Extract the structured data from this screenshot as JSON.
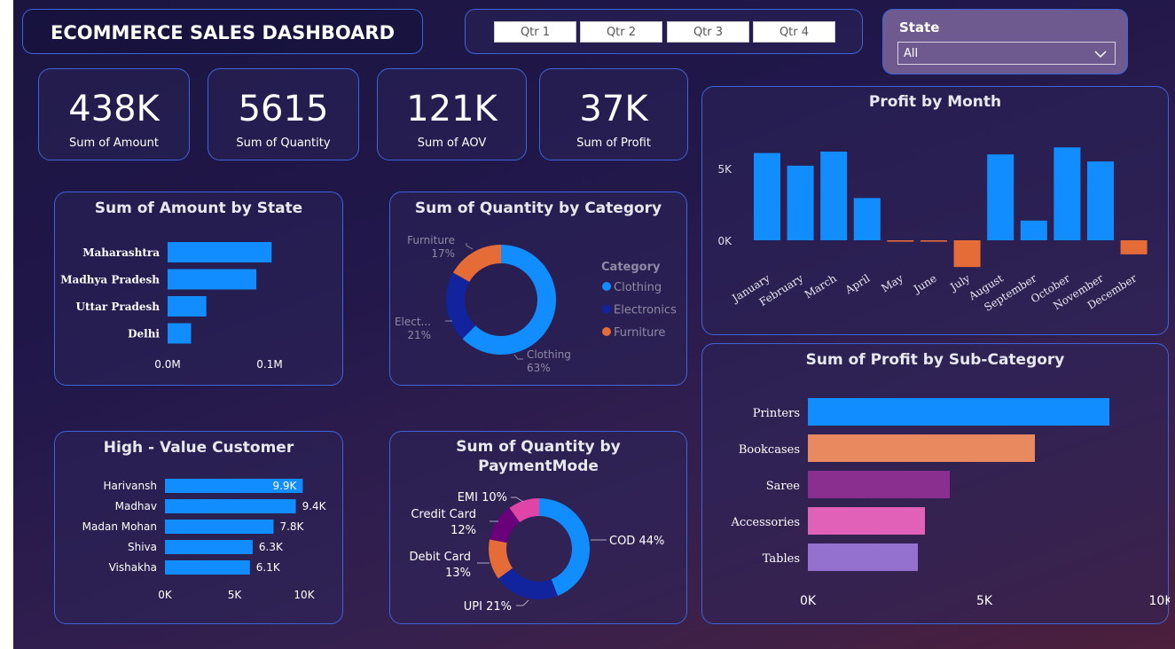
{
  "header": {
    "title": "ECOMMERCE SALES DASHBOARD"
  },
  "quarters": [
    "Qtr 1",
    "Qtr 2",
    "Qtr 3",
    "Qtr 4"
  ],
  "state_filter": {
    "label": "State",
    "value": "All"
  },
  "kpis": [
    {
      "value": "438K",
      "label": "Sum of Amount"
    },
    {
      "value": "5615",
      "label": "Sum of Quantity"
    },
    {
      "value": "121K",
      "label": "Sum of AOV"
    },
    {
      "value": "37K",
      "label": "Sum of Profit"
    }
  ],
  "colors": {
    "blue": "#118dff",
    "navy": "#12239e",
    "orange": "#e66c37",
    "purple": "#6b007b",
    "pink": "#e044a7",
    "salmon": "#e8895f",
    "violet": "#8a2f8f",
    "lavender": "#9470cf",
    "panel_border": "#3f63d8"
  },
  "chart_data": [
    {
      "id": "profit_by_month",
      "type": "bar",
      "title": "Profit by Month",
      "categories": [
        "January",
        "February",
        "March",
        "April",
        "May",
        "June",
        "July",
        "August",
        "September",
        "October",
        "November",
        "December"
      ],
      "values": [
        6200,
        5300,
        6300,
        3000,
        -100,
        -100,
        -1900,
        6100,
        1400,
        6600,
        5600,
        -1000
      ],
      "yticks": [
        "5K",
        "0K"
      ],
      "ylim": [
        -2000,
        7000
      ],
      "positive_color": "#118dff",
      "negative_color": "#e66c37"
    },
    {
      "id": "amount_by_state",
      "type": "bar",
      "orientation": "horizontal",
      "title": "Sum of Amount by State",
      "categories": [
        "Maharashtra",
        "Madhya Pradesh",
        "Uttar Pradesh",
        "Delhi"
      ],
      "values": [
        0.102,
        0.087,
        0.038,
        0.023
      ],
      "xticks": [
        "0.0M",
        "0.1M"
      ],
      "xlim": [
        0,
        0.1
      ]
    },
    {
      "id": "quantity_by_category",
      "type": "pie",
      "title": "Sum of Quantity by Category",
      "legend_title": "Category",
      "legend_position": "right",
      "slices": [
        {
          "name": "Clothing",
          "value": 63,
          "label": "Clothing",
          "pct": "63%",
          "color": "#118dff"
        },
        {
          "name": "Electronics",
          "value": 21,
          "label": "Elect...",
          "pct": "21%",
          "color": "#12239e"
        },
        {
          "name": "Furniture",
          "value": 17,
          "label": "Furniture",
          "pct": "17%",
          "color": "#e66c37"
        }
      ]
    },
    {
      "id": "high_value_customer",
      "type": "bar",
      "orientation": "horizontal",
      "title": "High - Value Customer",
      "categories": [
        "Harivansh",
        "Madhav",
        "Madan Mohan",
        "Shiva",
        "Vishakha"
      ],
      "values": [
        9.9,
        9.4,
        7.8,
        6.3,
        6.1
      ],
      "data_labels": [
        "9.9K",
        "9.4K",
        "7.8K",
        "6.3K",
        "6.1K"
      ],
      "xticks": [
        "0K",
        "5K",
        "10K"
      ],
      "xlim": [
        0,
        10
      ]
    },
    {
      "id": "quantity_by_paymentmode",
      "type": "pie",
      "title_lines": [
        "Sum of Quantity by",
        "PaymentMode"
      ],
      "slices": [
        {
          "name": "COD",
          "value": 44,
          "label": "COD 44%",
          "color": "#118dff"
        },
        {
          "name": "UPI",
          "value": 21,
          "label": "UPI 21%",
          "color": "#12239e"
        },
        {
          "name": "Debit Card",
          "value": 13,
          "label": "Debit Card 13%",
          "color": "#e66c37"
        },
        {
          "name": "Credit Card",
          "value": 12,
          "label": "Credit Card 12%",
          "color": "#6b007b"
        },
        {
          "name": "EMI",
          "value": 10,
          "label": "EMI 10%",
          "color": "#e044a7"
        }
      ]
    },
    {
      "id": "profit_by_subcategory",
      "type": "bar",
      "orientation": "horizontal",
      "title": "Sum of Profit by Sub-Category",
      "categories": [
        "Printers",
        "Bookcases",
        "Saree",
        "Accessories",
        "Tables"
      ],
      "values": [
        8500,
        6400,
        4000,
        3300,
        3100
      ],
      "colors": [
        "#118dff",
        "#e8895f",
        "#8a2f8f",
        "#e261b8",
        "#9470cf"
      ],
      "xticks": [
        "0K",
        "5K",
        "10K"
      ],
      "xlim": [
        0,
        10000
      ]
    }
  ]
}
